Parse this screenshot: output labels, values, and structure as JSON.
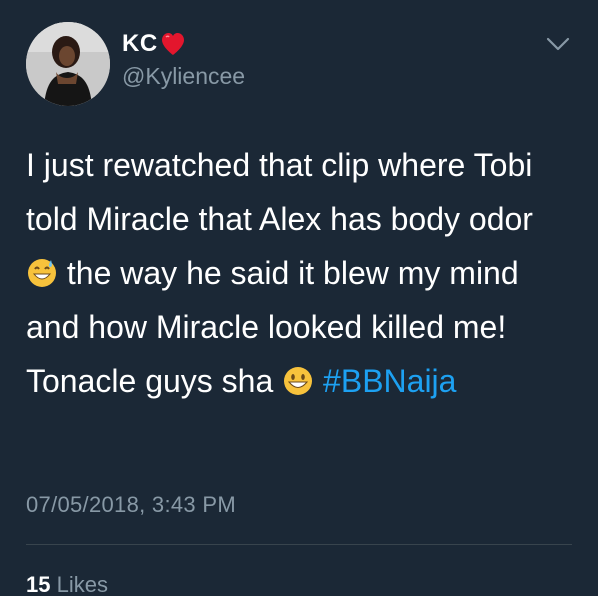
{
  "tweet": {
    "author": {
      "display_name": "KC",
      "handle": "@Kyliencee"
    },
    "text_parts": [
      "I just rewatched that clip where Tobi told Miracle that Alex has body odor ",
      " the way he said it blew my mind and how Miracle looked killed me! Tonacle guys sha ",
      " "
    ],
    "hashtag": "#BBNaija",
    "timestamp": "07/05/2018, 3:43 PM",
    "likes": {
      "count": "15",
      "label": "Likes"
    }
  },
  "icons": {
    "name_badge": "red-heart-icon",
    "menu": "chevron-down-icon",
    "emoji_1": "grinning-sweat-emoji-icon",
    "emoji_2": "grinning-face-emoji-icon"
  },
  "colors": {
    "background": "#1b2836",
    "text": "#ffffff",
    "secondary_text": "#8899a6",
    "hashtag": "#1da1f2",
    "divider": "#38444d"
  }
}
